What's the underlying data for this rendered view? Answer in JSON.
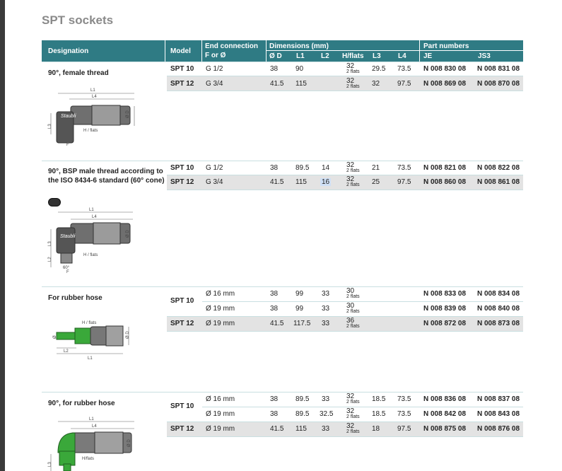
{
  "title": "SPT sockets",
  "header": {
    "designation": "Designation",
    "model": "Model",
    "end_connection": "End connection",
    "f_or_d": "F or Ø",
    "dimensions": "Dimensions (mm)",
    "d": "Ø D",
    "l1": "L1",
    "l2": "L2",
    "hflats": "H/flats",
    "l3": "L3",
    "l4": "L4",
    "part_numbers": "Part numbers",
    "je": "JE",
    "js3": "JS3"
  },
  "two_flats": "2 flats",
  "sections": [
    {
      "designation": "90°, female thread",
      "rows": [
        {
          "model": "SPT 10",
          "end": "G 1/2",
          "d": "38",
          "l1": "90",
          "l2": "",
          "h": "32",
          "l3": "29.5",
          "l4": "73.5",
          "je": "N 008 830 08",
          "js3": "N 008 831 08"
        },
        {
          "model": "SPT 12",
          "end": "G 3/4",
          "d": "41.5",
          "l1": "115",
          "l2": "",
          "h": "32",
          "l3": "32",
          "l4": "97.5",
          "je": "N 008 869 08",
          "js3": "N 008 870 08"
        }
      ],
      "drawing_labels": {
        "l1": "L1",
        "l4": "L4",
        "d": "Ø D",
        "l3": "L3",
        "h": "H / flats",
        "f": "F"
      }
    },
    {
      "designation": "90°, BSP male thread according to the ISO 8434-6 standard (60° cone)",
      "rows": [
        {
          "model": "SPT 10",
          "end": "G 1/2",
          "d": "38",
          "l1": "89.5",
          "l2": "14",
          "h": "32",
          "l3": "21",
          "l4": "73.5",
          "je": "N 008 821 08",
          "js3": "N 008 822 08"
        },
        {
          "model": "SPT 12",
          "end": "G 3/4",
          "d": "41.5",
          "l1": "115",
          "l2": "16",
          "h": "32",
          "l3": "25",
          "l4": "97.5",
          "je": "N 008 860 08",
          "js3": "N 008 861 08"
        }
      ],
      "drawing_labels": {
        "l1": "L1",
        "l4": "L4",
        "d": "Ø D",
        "l3": "L3",
        "l2": "L2",
        "h": "H / flats",
        "f": "F",
        "cone": "60°"
      }
    },
    {
      "designation": "For rubber hose",
      "rows": [
        {
          "model": "SPT 10",
          "end": "Ø 16 mm",
          "d": "38",
          "l1": "99",
          "l2": "33",
          "h": "30",
          "l3": "",
          "l4": "",
          "je": "N 008 833 08",
          "js3": "N 008 834 08"
        },
        {
          "model": "",
          "end": "Ø 19 mm",
          "d": "38",
          "l1": "99",
          "l2": "33",
          "h": "30",
          "l3": "",
          "l4": "",
          "je": "N 008 839 08",
          "js3": "N 008 840 08"
        },
        {
          "model": "SPT 12",
          "end": "Ø 19 mm",
          "d": "41.5",
          "l1": "117.5",
          "l2": "33",
          "h": "36",
          "l3": "",
          "l4": "",
          "je": "N 008 872 08",
          "js3": "N 008 873 08"
        }
      ],
      "drawing_labels": {
        "h": "H / flats",
        "l2": "L2",
        "l1": "L1",
        "d": "Ø D",
        "phi": "Ø"
      }
    },
    {
      "designation": "90°, for rubber hose",
      "rows": [
        {
          "model": "SPT 10",
          "end": "Ø 16 mm",
          "d": "38",
          "l1": "89.5",
          "l2": "33",
          "h": "32",
          "l3": "18.5",
          "l4": "73.5",
          "je": "N 008 836 08",
          "js3": "N 008 837 08"
        },
        {
          "model": "",
          "end": "Ø 19 mm",
          "d": "38",
          "l1": "89.5",
          "l2": "32.5",
          "h": "32",
          "l3": "18.5",
          "l4": "73.5",
          "je": "N 008 842 08",
          "js3": "N 008 843 08"
        },
        {
          "model": "SPT 12",
          "end": "Ø 19 mm",
          "d": "41.5",
          "l1": "115",
          "l2": "33",
          "h": "32",
          "l3": "18",
          "l4": "97.5",
          "je": "N 008 875 08",
          "js3": "N 008 876 08"
        }
      ],
      "drawing_labels": {
        "l1": "L1",
        "l4": "L4",
        "d": "Ø D",
        "h": "H/flats",
        "l3": "L3"
      }
    }
  ]
}
